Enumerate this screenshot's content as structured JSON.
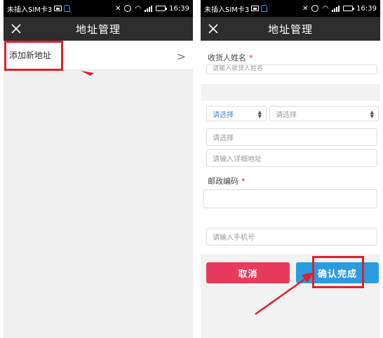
{
  "status_bar": {
    "carrier": "未插入SIM卡3",
    "time": "16:39"
  },
  "left_screen": {
    "title": "地址管理",
    "add_address_label": "添加新地址",
    "chevron": ">"
  },
  "right_screen": {
    "title": "地址管理",
    "consignee_label": "收货人姓名",
    "consignee_placeholder": "请输入收货人姓名",
    "required_mark": "*",
    "province_select": "请选择",
    "city_select": "请选择",
    "district_select": "请选择",
    "address_placeholder": "请输入详细地址",
    "postcode_label": "邮政编码",
    "phone_placeholder": "请输入手机号",
    "cancel_button": "取消",
    "confirm_button": "确认完成"
  },
  "colors": {
    "annotation_red": "#e0202a",
    "cancel_bg": "#e83a5c",
    "confirm_bg": "#2b9be0",
    "app_bar": "#2d2d2d"
  }
}
